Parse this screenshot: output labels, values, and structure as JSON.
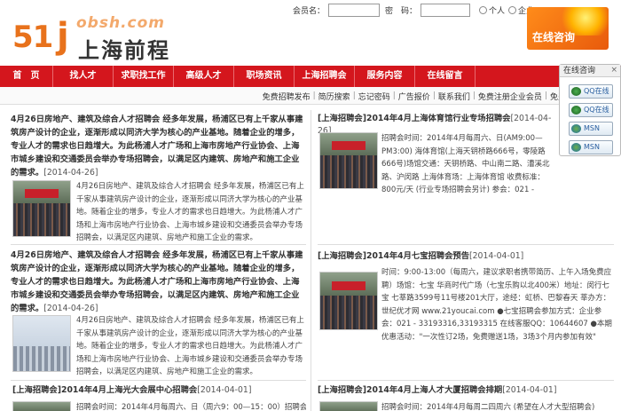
{
  "logo": {
    "number": "51",
    "j": "j",
    "domain": "obsh.com",
    "name": "上海前程"
  },
  "login": {
    "member_label": "会员名：",
    "password_label": "密　码：",
    "radio_person": "个人",
    "radio_company": "企业"
  },
  "banner": {
    "consult_text": "在线咨询"
  },
  "nav": [
    "首　页",
    "找人才",
    "求职找工作",
    "高级人才",
    "职场资讯",
    "上海招聘会",
    "服务内容",
    "在线留言"
  ],
  "subnav": [
    "免费招聘发布",
    "简历搜索",
    "忘记密码",
    "广告报价",
    "联系我们",
    "免费注册企业会员",
    "免费"
  ],
  "online": {
    "title": "在线咨询",
    "close": "×",
    "buttons": [
      "QQ在线",
      "QQ在线",
      "MSN",
      "MSN"
    ]
  },
  "articles": [
    {
      "lead": "4月26日房地产、建筑及综合人才招聘会 经多年发展，杨浦区已有上千家从事建筑房产设计的企业，逐渐形成以同济大学为核心的产业基地。随着企业的增多，专业人才的需求也日趋增大。为此杨浦人才广场和上海市房地产行业协会、上海市城乡建设和交通委员会举办专场招聘会，以满足区内建筑、房地产和施工企业的需求。",
      "date": "[2014-04-26]",
      "body": "4月26日房地产、建筑及综合人才招聘会 经多年发展，杨浦区已有上千家从事建筑房产设计的企业，逐渐形成以同济大学为核心的产业基地。随着企业的增多，专业人才的需求也日趋增大。为此杨浦人才广场和上海市房地产行业协会、上海市城乡建设和交通委员会举办专场招聘会，以满足区内建筑、房地产和施工企业的需求。"
    },
    {
      "title": "[上海招聘会]2014年4月上海体育馆行业专场招聘会",
      "date": "[2014-04-26]",
      "body": "招聘会时间：2014年4月每周六、日(AM9:00—PM3:00) 海体育馆(上海天钥桥路666号，零陵路666号)场馆交通：天钥桥路、中山南二路、漕溪北路、沪闵路 上海体育场：上海体育馆 收费标准：800元/天 (行业专场招聘会另计) 参会：021 - 33193316,33193340,33193341 (多线)"
    },
    {
      "lead": "4月26日房地产、建筑及综合人才招聘会 经多年发展，杨浦区已有上千家从事建筑房产设计的企业，逐渐形成以同济大学为核心的产业基地。随着企业的增多，专业人才的需求也日趋增大。为此杨浦人才广场和上海市房地产行业协会、上海市城乡建设和交通委员会举办专场招聘会，以满足区内建筑、房地产和施工企业的需求。",
      "date": "[2014-04-26]",
      "body": "4月26日房地产、建筑及综合人才招聘会 经多年发展，杨浦区已有上千家从事建筑房产设计的企业，逐渐形成以同济大学为核心的产业基地。随着企业的增多，专业人才的需求也日趋增大。为此杨浦人才广场和上海市房地产行业协会、上海市城乡建设和交通委员会举办专场招聘会，以满足区内建筑、房地产和施工企业的需求。"
    },
    {
      "title": "[上海招聘会]2014年4月七宝招聘会预告",
      "date": "[2014-04-01]",
      "body": "时间：9:00-13:00（每周六，建议求职者携带简历、上午入场免费应聘）场馆：七宝 华商时代广场（七宝乐购以北400米）地址：闵行七宝 七莘路3599号11号楼201大厅，途经：虹桥、巴黎春天 莘办方：世纪优才网 www.21youcai.com ●七宝招聘会参加方式：企业参会：021 - 33193316,33193315 在线客服QQ：10644607 ●本期优惠活动：\"一次性订2场，免费赠送1场，3场3个月内参加有效\""
    },
    {
      "title": "[上海招聘会]2014年4月上海光大会展中心招聘会",
      "date": "[2014-04-01]",
      "body": "招聘会时间：2014年4月每周六、日（周六9：00—15：00）招聘会"
    },
    {
      "title": "[上海招聘会]2014年4月上海人才大厦招聘会排期",
      "date": "[2014-04-01]",
      "body": "招聘会时间：2014年4月每周二四周六 (希望在人才大型招聘会)"
    }
  ]
}
